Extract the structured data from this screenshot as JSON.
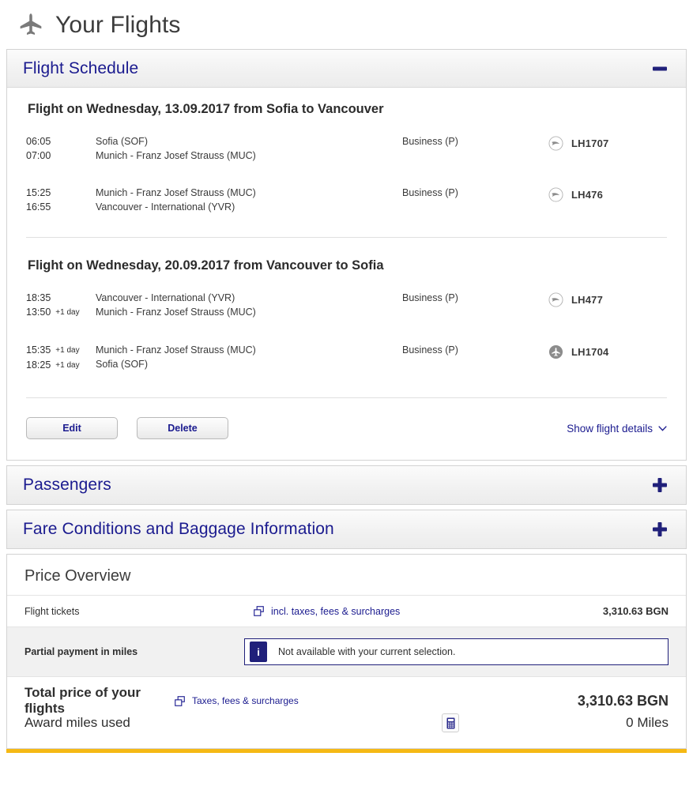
{
  "header": {
    "title": "Your Flights",
    "icon": "airplane-icon"
  },
  "sections": {
    "flight_schedule": {
      "title": "Flight Schedule",
      "toggle": "minus-icon",
      "expanded": true
    },
    "passengers": {
      "title": "Passengers",
      "toggle": "plus-icon",
      "expanded": false
    },
    "fare_conditions": {
      "title": "Fare Conditions and Baggage Information",
      "toggle": "plus-icon",
      "expanded": false
    }
  },
  "legs": [
    {
      "title": "Flight on Wednesday, 13.09.2017 from Sofia to Vancouver",
      "segments": [
        {
          "dep_time": "06:05",
          "dep_day": "",
          "arr_time": "07:00",
          "arr_day": "",
          "dep_place": "Sofia (SOF)",
          "arr_place": "Munich - Franz Josef Strauss (MUC)",
          "cabin": "Business (P)",
          "flight_no": "LH1707",
          "carrier_icon": "lufthansa-crane-icon"
        },
        {
          "dep_time": "15:25",
          "dep_day": "",
          "arr_time": "16:55",
          "arr_day": "",
          "dep_place": "Munich - Franz Josef Strauss (MUC)",
          "arr_place": "Vancouver - International (YVR)",
          "cabin": "Business (P)",
          "flight_no": "LH476",
          "carrier_icon": "lufthansa-crane-icon"
        }
      ]
    },
    {
      "title": "Flight on Wednesday, 20.09.2017 from Vancouver to Sofia",
      "segments": [
        {
          "dep_time": "18:35",
          "dep_day": "",
          "arr_time": "13:50",
          "arr_day": "+1 day",
          "dep_place": "Vancouver - International (YVR)",
          "arr_place": "Munich - Franz Josef Strauss (MUC)",
          "cabin": "Business (P)",
          "flight_no": "LH477",
          "carrier_icon": "lufthansa-crane-icon"
        },
        {
          "dep_time": "15:35",
          "dep_day": "+1 day",
          "arr_time": "18:25",
          "arr_day": "+1 day",
          "dep_place": "Munich - Franz Josef Strauss (MUC)",
          "arr_place": "Sofia (SOF)",
          "cabin": "Business (P)",
          "flight_no": "LH1704",
          "carrier_icon": "regional-plane-icon"
        }
      ]
    }
  ],
  "actions": {
    "edit_label": "Edit",
    "delete_label": "Delete",
    "details_label": "Show flight details",
    "details_icon": "chevron-down-icon"
  },
  "price": {
    "heading": "Price Overview",
    "rows": [
      {
        "label": "Flight tickets",
        "link": "incl. taxes, fees & surcharges",
        "link_icon": "popup-window-icon",
        "amount": "3,310.63 BGN"
      }
    ],
    "partial_payment": {
      "label": "Partial payment in miles",
      "info_badge": "i",
      "info_text": "Not available with your current selection."
    },
    "total": {
      "label": "Total price of your flights",
      "link": "Taxes, fees & surcharges",
      "link_icon": "popup-window-icon",
      "calculator_icon": "calculator-icon",
      "amount": "3,310.63 BGN"
    },
    "award": {
      "label": "Award miles used",
      "amount": "0 Miles"
    }
  },
  "colors": {
    "brand_navy": "#1b1b8f",
    "accent_yellow": "#f5b914",
    "text_dark": "#2f2f2f",
    "panel_border": "#d3d3d3"
  }
}
